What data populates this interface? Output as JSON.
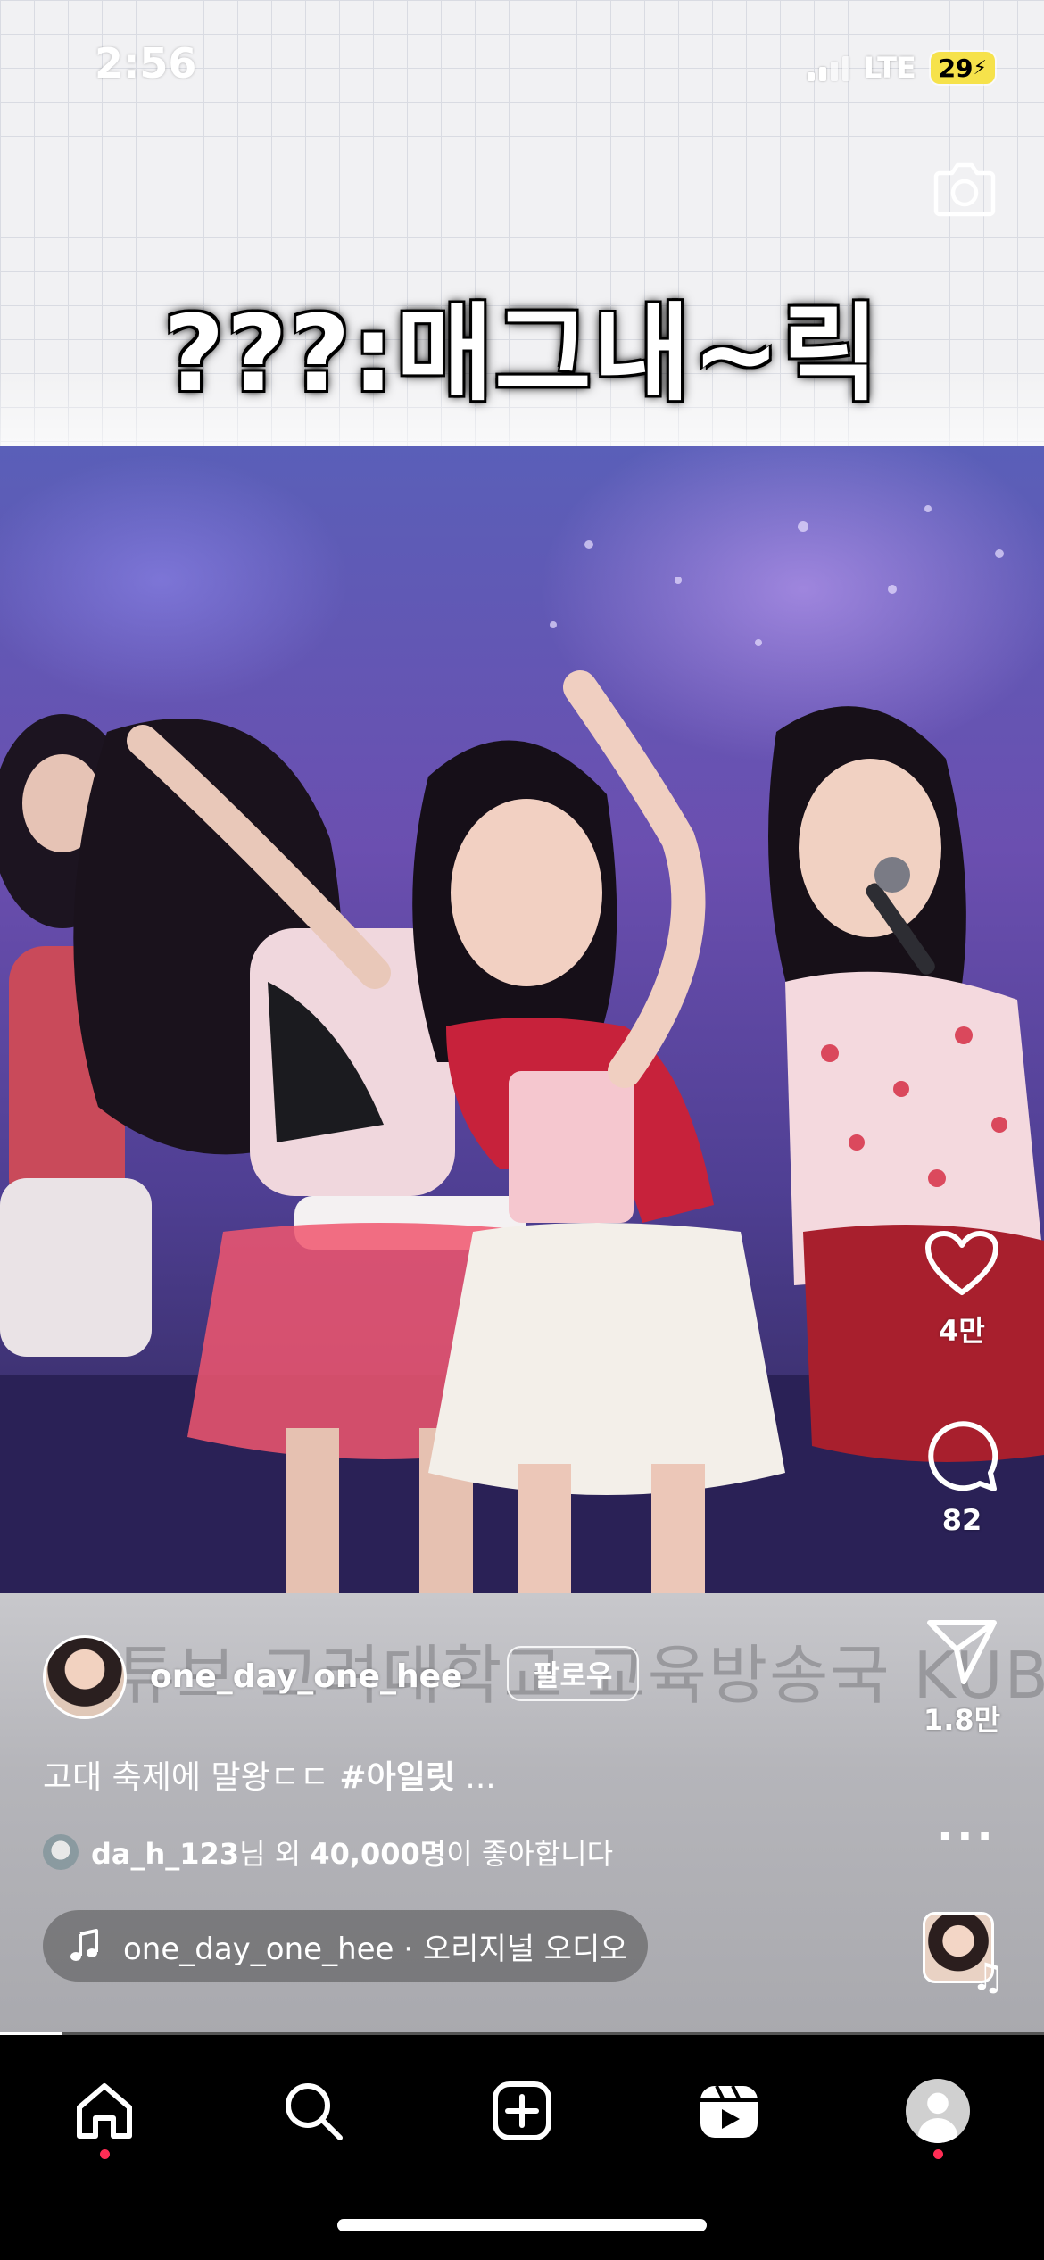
{
  "status_bar": {
    "time": "2:56",
    "network": "LTE",
    "battery": "29"
  },
  "header": {
    "camera_icon": "camera-icon"
  },
  "video": {
    "top_caption": "???:매그내~릭",
    "subtitle_watermark": "튜브 고려대학교 교육방송국 KUBS"
  },
  "post": {
    "username": "one_day_one_hee",
    "follow_label": "팔로우",
    "description_prefix": "고대 축제에 말왕ㄷㄷ ",
    "description_hashtag": "#아일릿",
    "description_more": " ...",
    "likes_user": "da_h_123",
    "likes_text_1": "님 외 ",
    "likes_count": "40,000명",
    "likes_text_2": "이 좋아합니다",
    "audio_label": "one_day_one_hee · 오리지널 오디오"
  },
  "actions": {
    "like_count": "4만",
    "comment_count": "82",
    "share_count": "1.8만"
  },
  "playback": {
    "progress": 0.06
  },
  "nav": {
    "items": [
      "home-icon",
      "search-icon",
      "create-icon",
      "reels-icon",
      "profile-avatar"
    ]
  },
  "colors": {
    "notification_dot": "#ff2d55",
    "battery": "#f6e24b",
    "nav_bg": "#000000"
  }
}
